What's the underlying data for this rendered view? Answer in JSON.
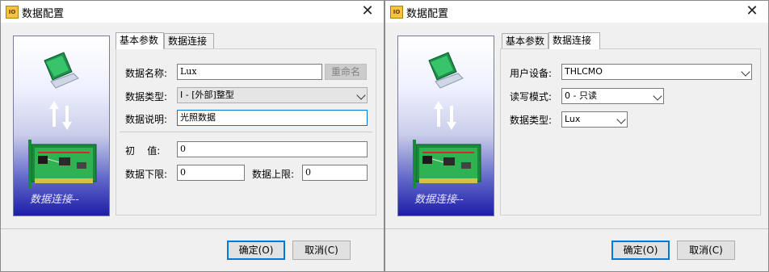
{
  "dialog1": {
    "title": "数据配置",
    "app_icon": "IO",
    "art_caption": "数据连接--",
    "tabs": [
      "基本参数",
      "数据连接"
    ],
    "fields": {
      "name_label": "数据名称:",
      "name_value": "Lux",
      "rename_button": "重命名",
      "type_label": "数据类型:",
      "type_value": "I - [外部]整型",
      "desc_label": "数据说明:",
      "desc_value": "光照数据",
      "initial_label": "初    值:",
      "initial_value": "0",
      "lower_label": "数据下限:",
      "lower_value": "0",
      "upper_label": "数据上限:",
      "upper_value": "0"
    },
    "ok_button": "确定(O)",
    "cancel_button": "取消(C)"
  },
  "dialog2": {
    "title": "数据配置",
    "app_icon": "IO",
    "art_caption": "数据连接--",
    "tabs": [
      "基本参数",
      "数据连接"
    ],
    "fields": {
      "device_label": "用户设备:",
      "device_value": "THLCMO",
      "mode_label": "读写模式:",
      "mode_value": "0 - 只读",
      "dtype_label": "数据类型:",
      "dtype_value": "Lux"
    },
    "ok_button": "确定(O)",
    "cancel_button": "取消(C)"
  },
  "colors": {
    "focus_border": "#0078d7",
    "art_bottom": "#1d1ea8",
    "art_top": "#ffffff"
  },
  "icons": [
    "app-io-icon",
    "close-icon",
    "computer-monitor-icon",
    "transfer-arrows-icon",
    "circuit-board-icon",
    "chevron-down-icon"
  ]
}
